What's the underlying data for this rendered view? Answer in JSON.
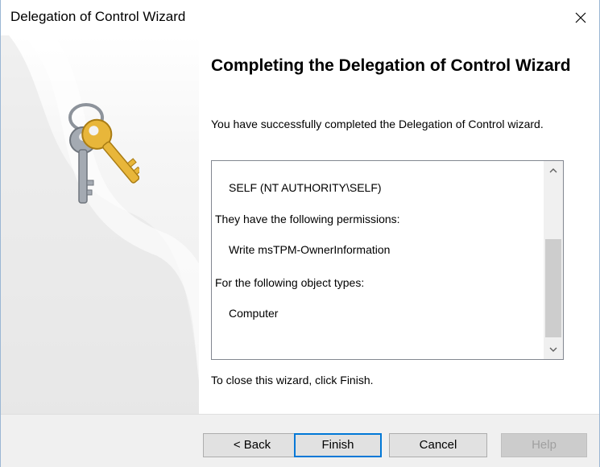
{
  "window": {
    "title": "Delegation of Control Wizard"
  },
  "main": {
    "heading": "Completing the Delegation of Control Wizard",
    "intro": "You have successfully completed the Delegation of Control wizard.",
    "summary_lines": [
      "SELF (NT AUTHORITY\\SELF)",
      "They have the following permissions:",
      "Write msTPM-OwnerInformation",
      "For the following object types:",
      "Computer"
    ],
    "close_note": "To close this wizard, click Finish."
  },
  "footer": {
    "back_label": "< Back",
    "finish_label": "Finish",
    "cancel_label": "Cancel",
    "help_label": "Help"
  },
  "icons": {
    "close": "close-icon",
    "keys": "keys-icon",
    "scroll_up": "chevron-up-icon",
    "scroll_down": "chevron-down-icon"
  },
  "colors": {
    "accent": "#0078d7",
    "key_gold": "#e8b63a",
    "key_gray": "#9aa0a8"
  }
}
